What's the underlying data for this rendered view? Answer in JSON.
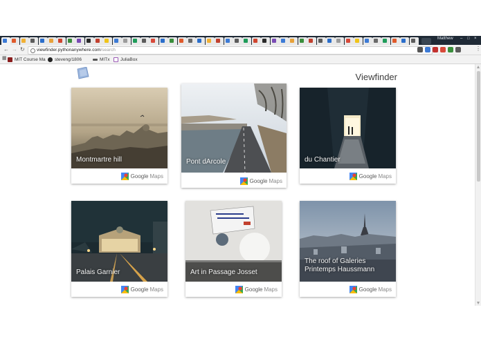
{
  "browser": {
    "user_name": "Matthew",
    "url_host": "viewfinder.pythonanywhere.com",
    "url_path": "/search",
    "tab_colors": [
      "#3d7bd6",
      "#e05a2b",
      "#f2b134",
      "#5c5c5c",
      "#2b6ecb",
      "#e8a23a",
      "#d0452f",
      "#3a8f3c",
      "#7a4bb5",
      "#2a2a2a",
      "#c2412f",
      "#f0c419",
      "#3d7bd6",
      "#9c9c9c",
      "#1f9c5a",
      "#5c5c5c",
      "#d84a3a",
      "#2b6ecb",
      "#3a8f3c",
      "#e05a2b",
      "#6a6a6a",
      "#2b6ecb",
      "#f2b134",
      "#c2412f",
      "#3d7bd6",
      "#5c5c5c",
      "#1f9c5a",
      "#d0452f",
      "#2a2a2a",
      "#7a4bb5",
      "#3d7bd6",
      "#e8a23a",
      "#3a8f3c",
      "#c2412f",
      "#5c5c5c",
      "#2b6ecb",
      "#9c9c9c",
      "#d84a3a",
      "#f0c419",
      "#3d7bd6",
      "#6a6a6a",
      "#1f9c5a",
      "#e05a2b",
      "#2b6ecb",
      "#5c5c5c"
    ],
    "extension_colors": [
      "#555555",
      "#3d7bd6",
      "#c2312f",
      "#d84a3a",
      "#3a8f3c",
      "#5c5c5c"
    ],
    "bookmarks": [
      {
        "label": "MIT Course Ma",
        "icon": "mit-icon",
        "color": "#8a1d1d"
      },
      {
        "label": "steveng/1806",
        "icon": "github-icon",
        "color": "#222222"
      },
      {
        "label": "MITx",
        "icon": "mitx-icon",
        "color": "#555555"
      },
      {
        "label": "JuliaBox",
        "icon": "juliabox-icon",
        "color": "#9a59b5"
      }
    ]
  },
  "page": {
    "title": "Viewfinder",
    "maps_google": "Google",
    "maps_label": "Maps"
  },
  "cards": [
    {
      "caption": "Montmartre hill",
      "scene": "hazy-skyline"
    },
    {
      "caption": "Pont dArcole",
      "scene": "river-bridge"
    },
    {
      "caption": "du Chantier",
      "scene": "dark-alley"
    },
    {
      "caption": "Palais Garnier",
      "scene": "opera-night"
    },
    {
      "caption": "Art in Passage Josset",
      "scene": "street-art"
    },
    {
      "caption": "The roof of Galeries Printemps Haussmann",
      "scene": "rooftop-eiffel"
    }
  ]
}
